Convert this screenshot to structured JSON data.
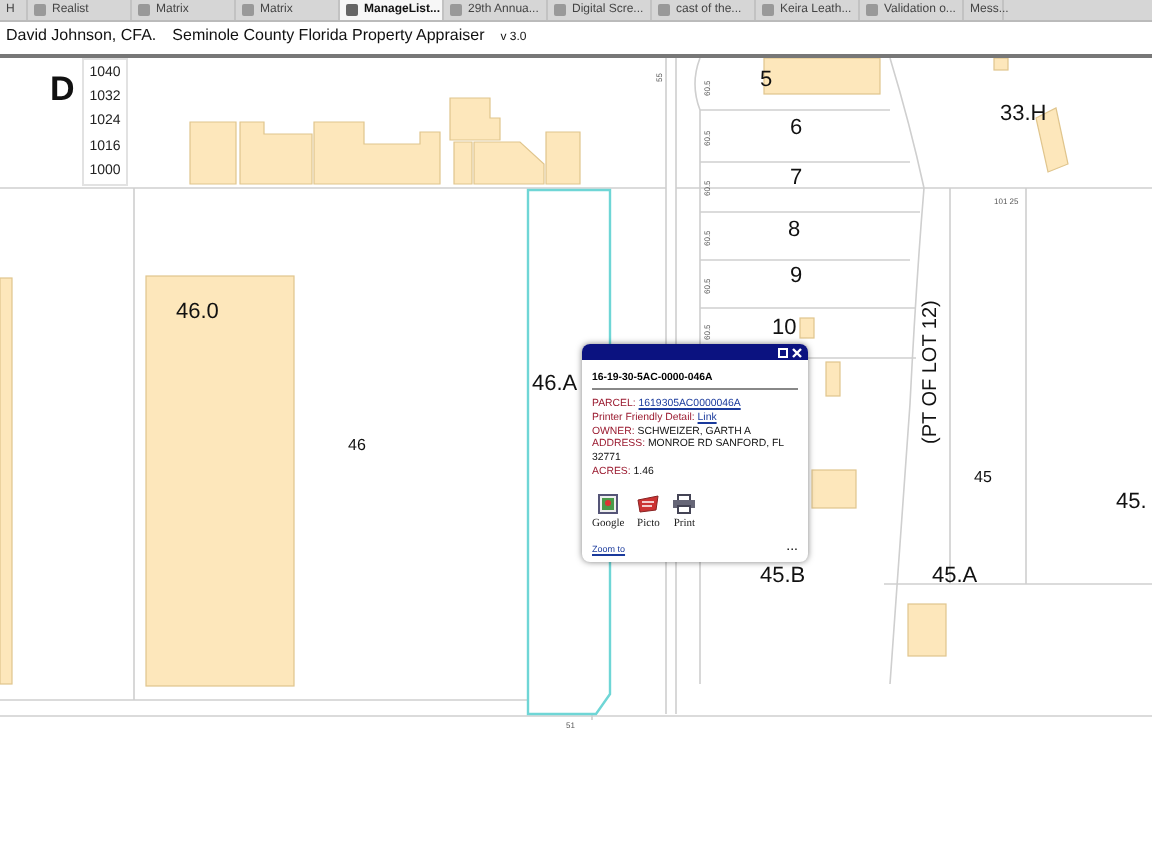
{
  "tabs": [
    {
      "label": "H",
      "selected": false
    },
    {
      "label": "Realist",
      "selected": false
    },
    {
      "label": "Matrix",
      "selected": false
    },
    {
      "label": "Matrix",
      "selected": false
    },
    {
      "label": "ManageList...",
      "selected": true
    },
    {
      "label": "29th Annua...",
      "selected": false
    },
    {
      "label": "Digital Scre...",
      "selected": false
    },
    {
      "label": "cast of the...",
      "selected": false
    },
    {
      "label": "Keira Leath...",
      "selected": false
    },
    {
      "label": "Validation o...",
      "selected": false
    },
    {
      "label": "Mess...",
      "selected": false
    }
  ],
  "header": {
    "owner": "David Johnson, CFA.",
    "title": "Seminole County Florida Property Appraiser",
    "version": "v 3.0"
  },
  "map": {
    "addresses": [
      "1040",
      "1032",
      "1024",
      "1016",
      "1000"
    ],
    "labels": [
      {
        "text": "D",
        "kind": "block"
      },
      {
        "text": "46.0",
        "kind": "parcel"
      },
      {
        "text": "46",
        "kind": "lot"
      },
      {
        "text": "46.A",
        "kind": "parcel"
      },
      {
        "text": "5",
        "kind": "parcel"
      },
      {
        "text": "6",
        "kind": "parcel"
      },
      {
        "text": "7",
        "kind": "parcel"
      },
      {
        "text": "8",
        "kind": "parcel"
      },
      {
        "text": "9",
        "kind": "parcel"
      },
      {
        "text": "10",
        "kind": "parcel"
      },
      {
        "text": "33.H",
        "kind": "parcel"
      },
      {
        "text": "(PT OF LOT 12)",
        "kind": "vertical"
      },
      {
        "text": "45",
        "kind": "lot"
      },
      {
        "text": "45.",
        "kind": "parcel"
      },
      {
        "text": "45.B",
        "kind": "parcel"
      },
      {
        "text": "45.A",
        "kind": "parcel"
      },
      {
        "text": "55",
        "kind": "dimension"
      },
      {
        "text": "60.5",
        "kind": "dimension"
      },
      {
        "text": "60.5",
        "kind": "dimension"
      },
      {
        "text": "60.5",
        "kind": "dimension"
      },
      {
        "text": "60.5",
        "kind": "dimension"
      },
      {
        "text": "60.5",
        "kind": "dimension"
      },
      {
        "text": "60.5",
        "kind": "dimension"
      },
      {
        "text": "101 25",
        "kind": "measure"
      },
      {
        "text": "51",
        "kind": "measure"
      }
    ]
  },
  "popup": {
    "parcel_id": "16-19-30-5AC-0000-046A",
    "fields": [
      {
        "label": "PARCEL:",
        "value": "1619305AC0000046A",
        "kind": "link"
      },
      {
        "label": "Printer Friendly Detail:",
        "value": "Link",
        "kind": "link"
      },
      {
        "label": "OWNER:",
        "value": "SCHWEIZER, GARTH A",
        "kind": "text"
      },
      {
        "label": "ADDRESS:",
        "value": "MONROE RD SANFORD, FL 32771",
        "kind": "text"
      },
      {
        "label": "ACRES:",
        "value": "1.46",
        "kind": "text"
      }
    ],
    "tools": [
      {
        "label": "Google"
      },
      {
        "label": "Picto"
      },
      {
        "label": "Print"
      }
    ],
    "zoom_link": "Zoom to",
    "more": "..."
  }
}
